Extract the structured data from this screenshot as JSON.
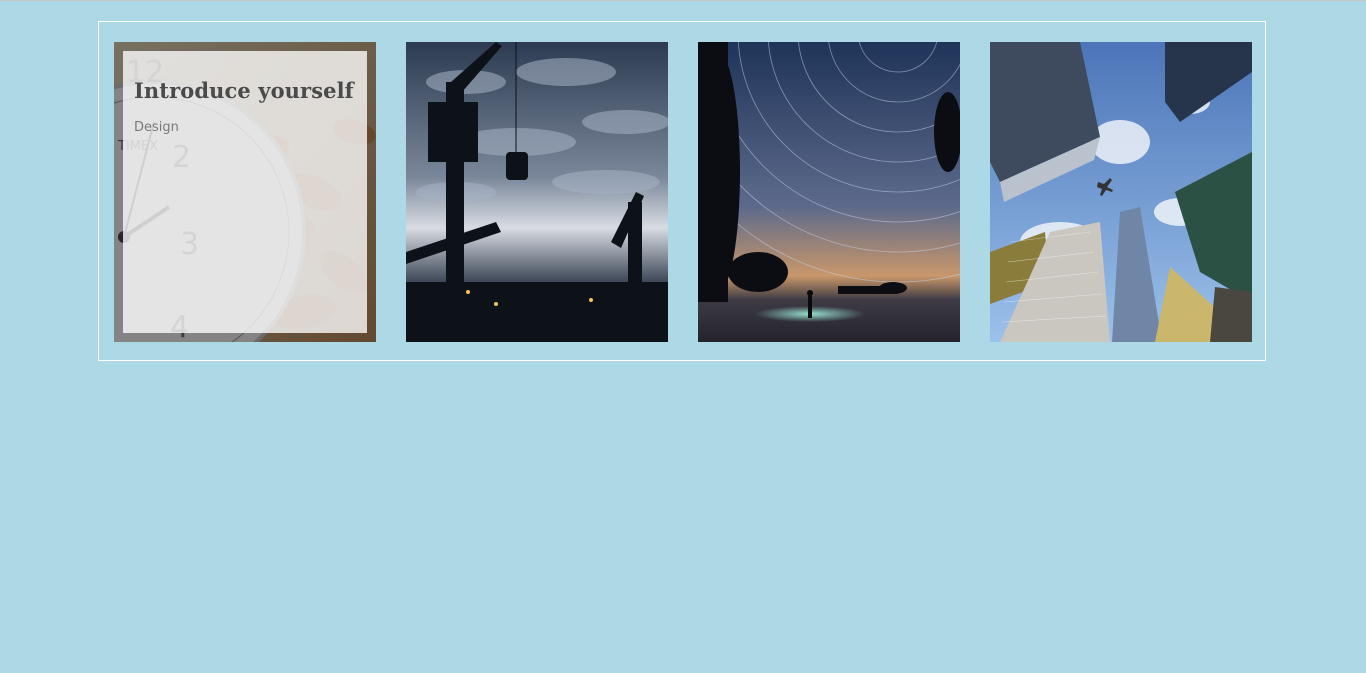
{
  "gallery": {
    "items": [
      {
        "title": "Introduce yourself",
        "category": "Design",
        "image": "clock-and-autumn-leaves"
      },
      {
        "image": "harbor-cranes-cloudy-sky"
      },
      {
        "image": "star-trails-night-sky"
      },
      {
        "image": "skyscrapers-looking-up"
      }
    ]
  },
  "colors": {
    "background": "#add8e6",
    "frame": "#ffffff"
  }
}
